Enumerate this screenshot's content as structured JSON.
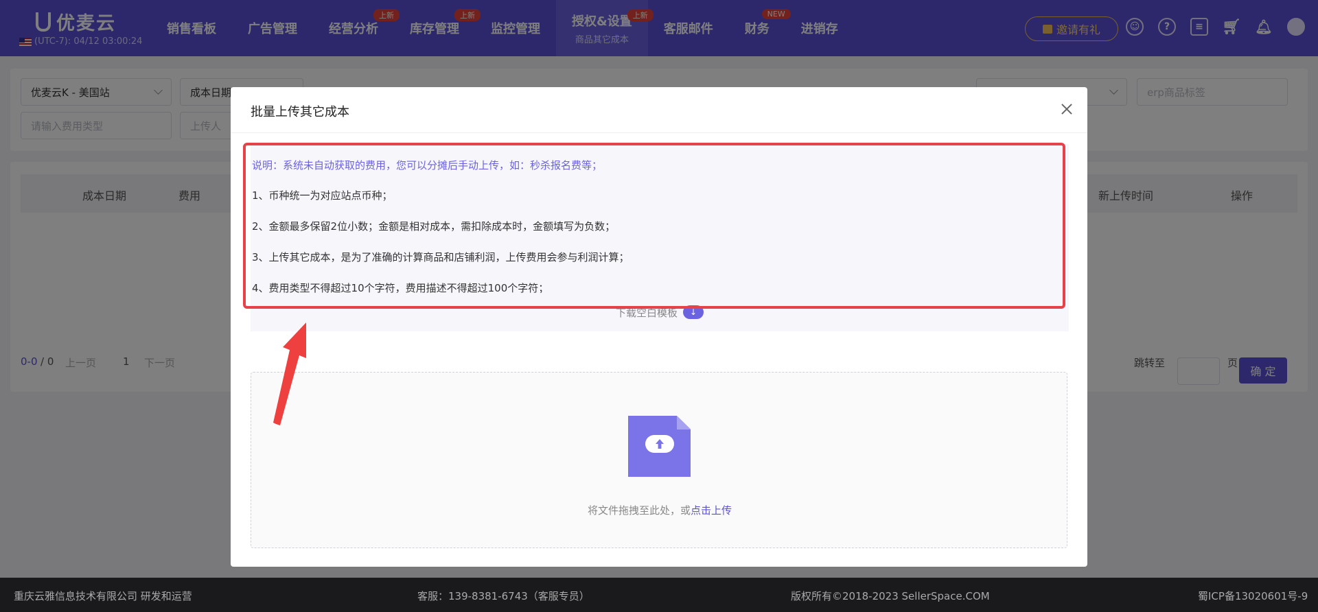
{
  "header": {
    "logo": "优麦云",
    "clock": "(UTC-7): 04/12 03:00:24",
    "nav": [
      {
        "label": "销售看板",
        "badge": "",
        "sub": ""
      },
      {
        "label": "广告管理",
        "badge": "",
        "sub": ""
      },
      {
        "label": "经营分析",
        "badge": "上新",
        "sub": ""
      },
      {
        "label": "库存管理",
        "badge": "上新",
        "sub": ""
      },
      {
        "label": "监控管理",
        "badge": "",
        "sub": ""
      },
      {
        "label": "授权&设置",
        "badge": "上新",
        "sub": "商品其它成本",
        "active": true
      },
      {
        "label": "客服邮件",
        "badge": "",
        "sub": ""
      },
      {
        "label": "财务",
        "badge": "NEW",
        "sub": ""
      },
      {
        "label": "进销存",
        "badge": "",
        "sub": ""
      }
    ],
    "invite": "邀请有礼"
  },
  "filters": {
    "store": "优麦云K - 美国站",
    "cost_date": "成本日期",
    "tag_placeholder": "erp商品标签",
    "fee_type_placeholder": "请输入费用类型",
    "uploader": "上传人"
  },
  "table": {
    "col_cost_date": "成本日期",
    "col_fee": "费用",
    "col_upload_time": "新上传时间",
    "col_action": "操作"
  },
  "pager": {
    "range": "0-0",
    "total": "/ 0",
    "prev": "上一页",
    "page": "1",
    "next": "下一页",
    "jump": "跳转至",
    "page_unit": "页",
    "confirm": "确 定"
  },
  "modal": {
    "title": "批量上传其它成本",
    "intro": "说明：系统未自动获取的费用，您可以分摊后手动上传，如：秒杀报名费等；",
    "notes": [
      "1、币种统一为对应站点币种；",
      "2、金额最多保留2位小数；金额是相对成本，需扣除成本时，金额填写为负数；",
      "3、上传其它成本，是为了准确的计算商品和店铺利润，上传费用会参与利润计算；",
      "4、费用类型不得超过10个字符，费用描述不得超过100个字符；"
    ],
    "download": "下载空白模板",
    "drop_text": "将文件拖拽至此处，或",
    "drop_link": "点击上传"
  },
  "footer": {
    "company": "重庆云雅信息技术有限公司 研发和运营",
    "service": "客服：139-8381-6743（客服专员）",
    "copyright": "版权所有©2018-2023 SellerSpace.COM",
    "icp": "蜀ICP备13020601号-9"
  }
}
